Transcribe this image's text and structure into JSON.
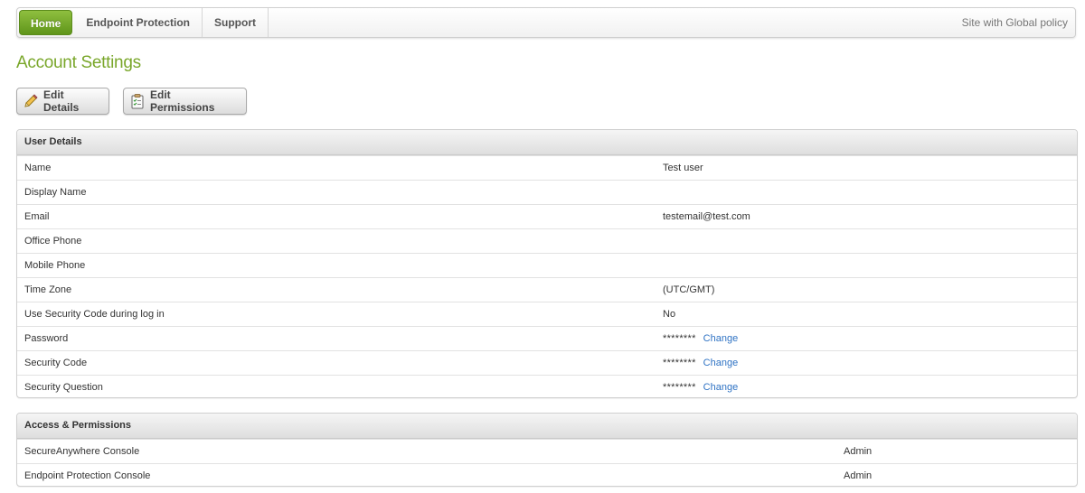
{
  "nav": {
    "items": [
      "Home",
      "Endpoint Protection",
      "Support"
    ],
    "site_label": "Site with Global policy"
  },
  "page": {
    "title": "Account Settings"
  },
  "toolbar": {
    "edit_details_label": "Edit Details",
    "edit_permissions_label": "Edit Permissions",
    "edit_details_icon": "pencil-icon",
    "edit_permissions_icon": "checklist-icon"
  },
  "user_details": {
    "header": "User Details",
    "rows": [
      {
        "label": "Name",
        "value": "Test user"
      },
      {
        "label": "Display Name",
        "value": ""
      },
      {
        "label": "Email",
        "value": "testemail@test.com"
      },
      {
        "label": "Office Phone",
        "value": ""
      },
      {
        "label": "Mobile Phone",
        "value": ""
      },
      {
        "label": "Time Zone",
        "value": "(UTC/GMT)"
      },
      {
        "label": "Use Security Code during log in",
        "value": "No"
      },
      {
        "label": "Password",
        "value": "********",
        "link": "Change"
      },
      {
        "label": "Security Code",
        "value": "********",
        "link": "Change"
      },
      {
        "label": "Security Question",
        "value": "********",
        "link": "Change"
      }
    ]
  },
  "access": {
    "header": "Access & Permissions",
    "rows": [
      {
        "label": "SecureAnywhere Console",
        "value": "Admin"
      },
      {
        "label": "Endpoint Protection Console",
        "value": "Admin"
      }
    ]
  },
  "colors": {
    "accent_green": "#7aa72b",
    "link_blue": "#2f73c4"
  }
}
